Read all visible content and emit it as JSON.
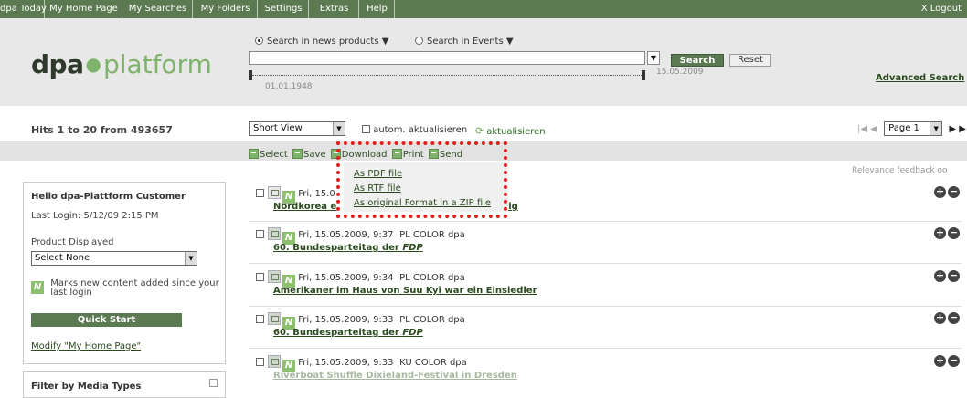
{
  "topnav": {
    "items": [
      "dpa Today",
      "My Home Page",
      "My Searches",
      "My Folders",
      "Settings",
      "Extras",
      "Help"
    ],
    "logout": "X Logout"
  },
  "logo": {
    "dpa": "dpa",
    "platform": "platform"
  },
  "search": {
    "radio_news": "Search in news products",
    "radio_events": "Search in Events",
    "query": "",
    "search_label": "Search",
    "reset_label": "Reset",
    "date_from": "01.01.1948",
    "date_to": "15.05.2009",
    "advanced": "Advanced Search"
  },
  "hits": "Hits 1 to 20 from 493657",
  "view": {
    "selected": "Short View",
    "autom": "autom. aktualisieren",
    "refresh": "aktualisieren"
  },
  "pager": {
    "page": "Page 1"
  },
  "actions": {
    "select": "Select",
    "save": "Save",
    "download": "Download",
    "print": "Print",
    "send": "Send",
    "relevance": "Relevance feedback"
  },
  "download_menu": [
    "As PDF file",
    "As RTF file",
    "As original Format in a ZIP file"
  ],
  "welcome": {
    "title": "Hello dpa-Plattform Customer",
    "last_login": "Last Login: 5/12/09 2:15 PM",
    "product_label": "Product Displayed",
    "product_selected": "Select None",
    "legend_line1": "Marks new content added since your",
    "legend_line2": "last login",
    "quickstart": "Quick Start",
    "modify": "Modify \"My Home Page\""
  },
  "filter": {
    "title": "Filter by Media Types"
  },
  "results": [
    {
      "date": "Fri, 15.0",
      "meta": "",
      "headline_a": "Nordkorea e",
      "headline_b": "ntig",
      "partial": true
    },
    {
      "date": "Fri, 15.05.2009, 9:37",
      "meta": "PL COLOR dpa",
      "headline": "60. Bundesparteitag der FDP"
    },
    {
      "date": "Fri, 15.05.2009, 9:34",
      "meta": "PL COLOR dpa",
      "headline": "Amerikaner im Haus von Suu Kyi war ein Einsiedler"
    },
    {
      "date": "Fri, 15.05.2009, 9:33",
      "meta": "PL COLOR dpa",
      "headline": "60. Bundesparteitag der FDP"
    },
    {
      "date": "Fri, 15.05.2009, 9:33",
      "meta": "KU COLOR dpa",
      "headline": "Riverboat Shuffle Dixieland-Festival in Dresden"
    }
  ],
  "colors": {
    "nav": "#5c7a52",
    "accent": "#7fb26a",
    "highlight": "#e02020",
    "link": "#2a4a1e"
  }
}
